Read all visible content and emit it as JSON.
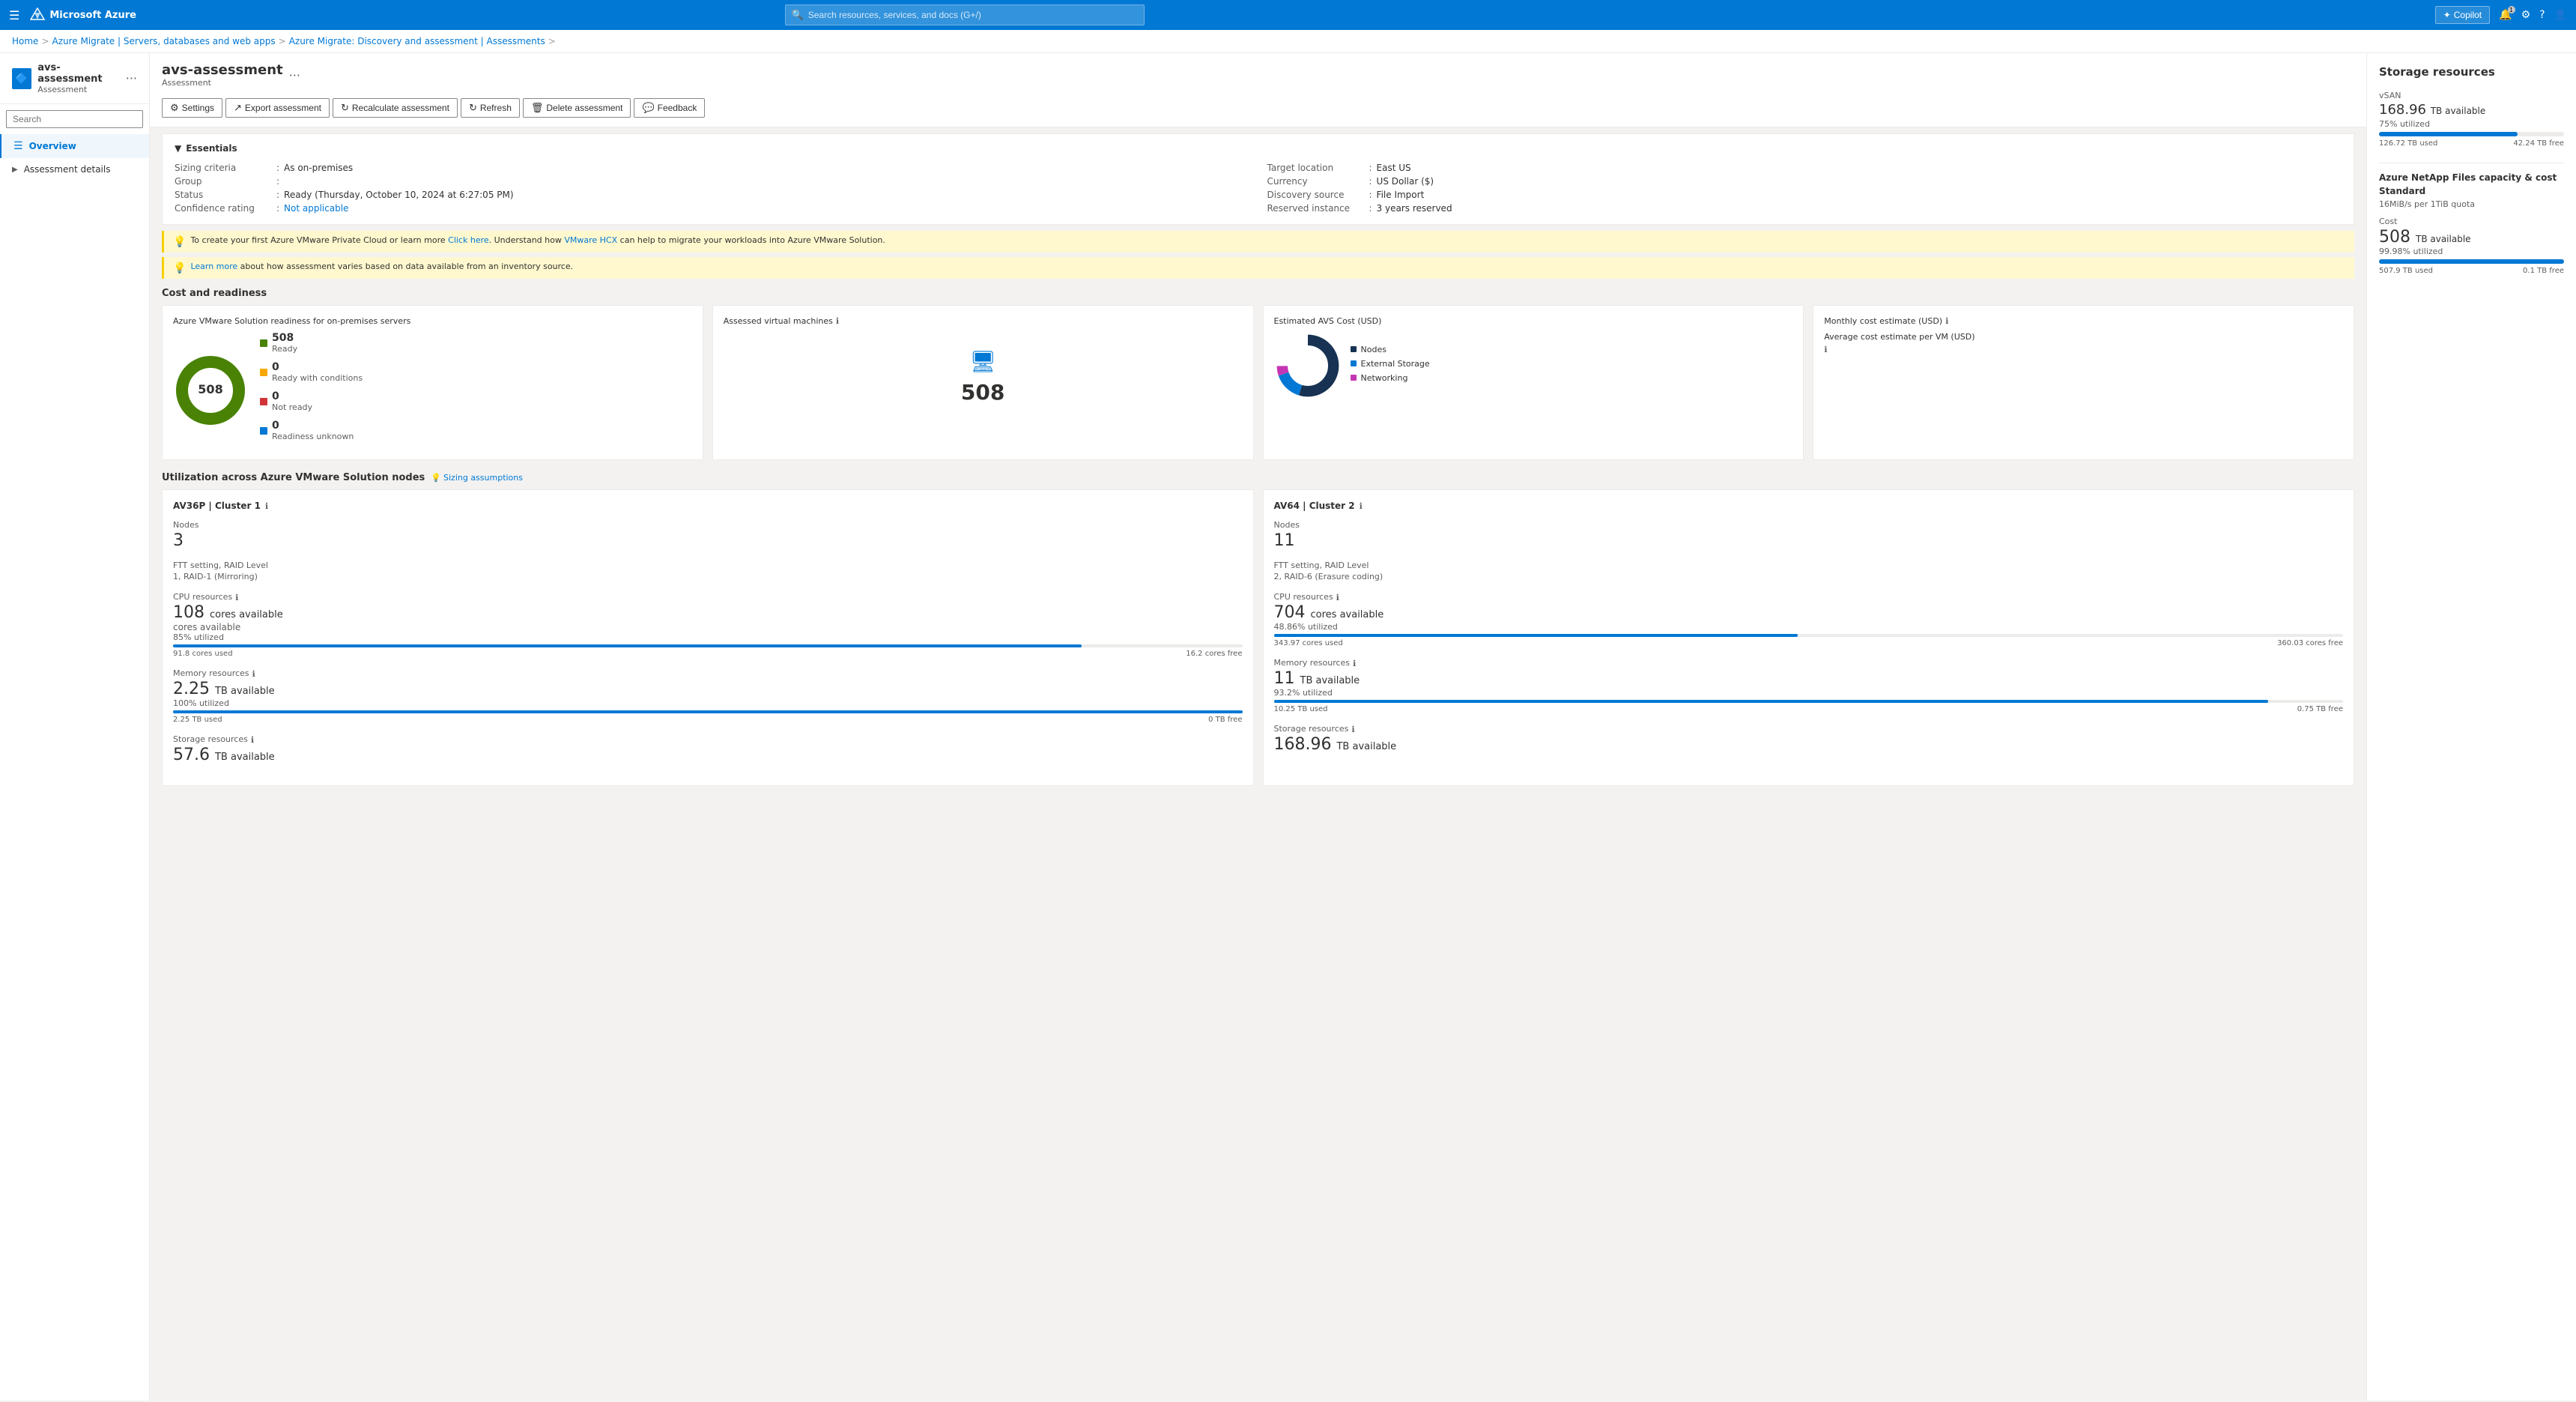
{
  "topbar": {
    "logo_text": "Microsoft Azure",
    "search_placeholder": "Search resources, services, and docs (G+/)",
    "copilot_label": "Copilot"
  },
  "breadcrumb": {
    "items": [
      "Home",
      "Azure Migrate | Servers, databases and web apps",
      "Azure Migrate: Discovery and assessment | Assessments"
    ]
  },
  "sidebar": {
    "logo_icon": "🔷",
    "title": "avs-assessment",
    "subtitle": "Assessment",
    "search_placeholder": "Search",
    "nav_items": [
      {
        "label": "Overview",
        "active": true,
        "icon": "☰"
      },
      {
        "label": "Assessment details",
        "active": false,
        "icon": "▶"
      }
    ]
  },
  "toolbar": {
    "buttons": [
      {
        "label": "Settings",
        "icon": "⚙"
      },
      {
        "label": "Export assessment",
        "icon": "↗"
      },
      {
        "label": "Recalculate assessment",
        "icon": "↻"
      },
      {
        "label": "Refresh",
        "icon": "↻"
      },
      {
        "label": "Delete assessment",
        "icon": "🗑"
      },
      {
        "label": "Feedback",
        "icon": "💬"
      }
    ]
  },
  "essentials": {
    "title": "Essentials",
    "fields_left": [
      {
        "label": "Sizing criteria",
        "value": "As on-premises"
      },
      {
        "label": "Group",
        "value": ":"
      },
      {
        "label": "Status",
        "value": "Ready (Thursday, October 10, 2024 at 6:27:05 PM)"
      },
      {
        "label": "Confidence rating",
        "value": "Not applicable",
        "is_link": true
      }
    ],
    "fields_right": [
      {
        "label": "Target location",
        "value": "East US"
      },
      {
        "label": "Currency",
        "value": "US Dollar ($)"
      },
      {
        "label": "Discovery source",
        "value": "File Import"
      },
      {
        "label": "Reserved instance",
        "value": "3 years reserved"
      }
    ]
  },
  "info_banners": [
    {
      "text": "To create your first Azure VMware Private Cloud or learn more",
      "link1_text": "Click here",
      "middle_text": ". Understand how",
      "link2_text": "VMware HCX",
      "end_text": "can help to migrate your workloads into Azure VMware Solution."
    },
    {
      "text": "Learn more",
      "end_text": "about how assessment varies based on data available from an inventory source."
    }
  ],
  "cost_readiness": {
    "section_title": "Cost and readiness",
    "donut_card": {
      "title": "Azure VMware Solution readiness for on-premises servers",
      "center_value": "508",
      "legend": [
        {
          "label": "Ready",
          "value": "508",
          "color": "#498205"
        },
        {
          "label": "Ready with conditions",
          "value": "0",
          "color": "#f7a800"
        },
        {
          "label": "Not ready",
          "value": "0",
          "color": "#d13438"
        },
        {
          "label": "Readiness unknown",
          "value": "0",
          "color": "#0078d4"
        }
      ]
    },
    "assessed_vms_card": {
      "title": "Assessed virtual machines",
      "info": true,
      "count": "508"
    },
    "avs_cost_card": {
      "title": "Estimated AVS Cost (USD)",
      "legend": [
        {
          "label": "Nodes",
          "color": "#173252"
        },
        {
          "label": "External Storage",
          "color": "#0078d4"
        },
        {
          "label": "Networking",
          "color": "#c435b3"
        }
      ]
    },
    "monthly_cost_card": {
      "title": "Monthly cost estimate (USD)",
      "info": true,
      "sub_label": "Average cost estimate per VM (USD)",
      "sub_info": true
    }
  },
  "utilization": {
    "title": "Utilization across Azure VMware Solution nodes",
    "sizing_link": "Sizing assumptions",
    "clusters": [
      {
        "title": "AV36P | Cluster 1",
        "nodes_label": "Nodes",
        "nodes_value": "3",
        "ftt_label": "FTT setting, RAID Level",
        "ftt_value": "1, RAID-1 (Mirroring)",
        "cpu_label": "CPU resources",
        "cpu_value": "108",
        "cpu_unit": "cores available",
        "cpu_utilized": "85% utilized",
        "cpu_bar_pct": 85,
        "cpu_used": "91.8 cores used",
        "cpu_free": "16.2 cores free",
        "mem_label": "Memory resources",
        "mem_value": "2.25",
        "mem_unit": "TB available",
        "mem_utilized": "100% utilized",
        "mem_bar_pct": 100,
        "mem_used": "2.25 TB used",
        "mem_free": "0 TB free",
        "storage_label": "Storage resources",
        "storage_value": "57.6",
        "storage_unit": "TB available"
      },
      {
        "title": "AV64 | Cluster 2",
        "nodes_label": "Nodes",
        "nodes_value": "11",
        "ftt_label": "FTT setting, RAID Level",
        "ftt_value": "2, RAID-6 (Erasure coding)",
        "cpu_label": "CPU resources",
        "cpu_value": "704",
        "cpu_unit": "cores available",
        "cpu_utilized": "48.86% utilized",
        "cpu_bar_pct": 49,
        "cpu_used": "343.97 cores used",
        "cpu_free": "360.03 cores free",
        "mem_label": "Memory resources",
        "mem_value": "11",
        "mem_unit": "TB available",
        "mem_utilized": "93.2% utilized",
        "mem_bar_pct": 93,
        "mem_used": "10.25 TB used",
        "mem_free": "0.75 TB free",
        "storage_label": "Storage resources",
        "storage_value": "168.96",
        "storage_unit": "TB available"
      }
    ]
  },
  "right_panel": {
    "title": "Storage resources",
    "vsan_label": "vSAN",
    "vsan_value": "168.96",
    "vsan_unit": "TB available",
    "vsan_utilized": "75% utilized",
    "vsan_used": "126.72 TB used",
    "vsan_free": "42.24 TB free",
    "vsan_bar_pct": 75,
    "anf_title": "Azure NetApp Files capacity & cost",
    "standard_label": "Standard",
    "standard_desc": "16MiB/s per 1TiB quota",
    "cost_label": "Cost",
    "cost_value": "508",
    "cost_unit": "TB available",
    "cost_utilized": "99.98% utilized",
    "cost_used": "507.9 TB used",
    "cost_free": "0.1 TB free",
    "cost_bar_pct": 100
  }
}
